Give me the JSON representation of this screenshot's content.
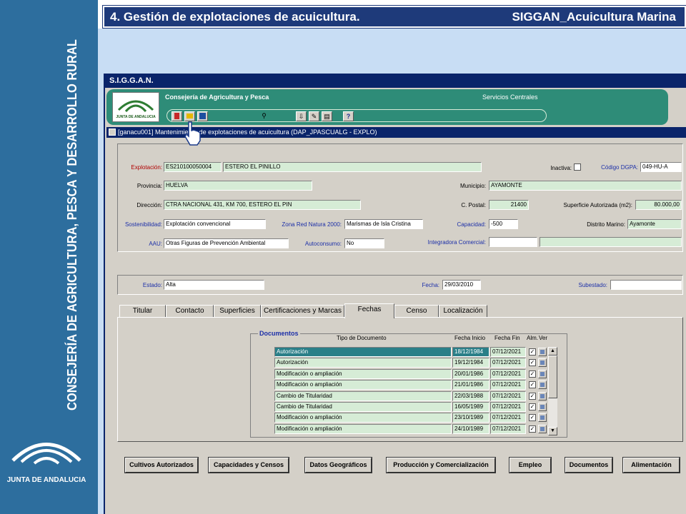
{
  "sidebar": {
    "vertical_text": "CONSEJERÍA DE AGRICULTURA, PESCA Y DESARROLLO RURAL",
    "logo_caption": "JUNTA DE ANDALUCIA"
  },
  "header": {
    "title": "4. Gestión de explotaciones de acuicultura.",
    "right": "SIGGAN_Acuicultura Marina"
  },
  "window": {
    "title": "S.I.G.G.A.N."
  },
  "appbar": {
    "logo_caption": "JUNTA DE ANDALUCIA",
    "consejeria": "Consejería de Agricultura y Pesca",
    "servicios": "Servicios Centrales"
  },
  "form_title": "[ganacu001] Mantenimiento de explotaciones de acuicultura   (DAP_JPASCUALG - EXPLO)",
  "form": {
    "explotacion_label": "Explotación:",
    "explotacion_code": "ES210100050004",
    "explotacion_name": "ESTERO EL PINILLO",
    "inactiva_label": "Inactiva:",
    "codigo_dgpa_label": "Código DGPA:",
    "codigo_dgpa": "049-HU-A",
    "provincia_label": "Provincia:",
    "provincia": "HUELVA",
    "municipio_label": "Municipio:",
    "municipio": "AYAMONTE",
    "direccion_label": "Dirección:",
    "direccion": "CTRA NACIONAL 431, KM 700, ESTERO EL PIN",
    "cpostal_label": "C. Postal:",
    "cpostal": "21400",
    "superficie_label": "Superficie Autorizada (m2):",
    "superficie": "80.000,00",
    "sostenibilidad_label": "Sostenibilidad:",
    "sostenibilidad": "Explotación convencional",
    "zona_label": "Zona Red Natura 2000:",
    "zona": "Marismas de Isla Cristina",
    "capacidad_label": "Capacidad:",
    "capacidad": "-500",
    "distrito_label": "Distrito Marino:",
    "distrito": "Ayamonte",
    "aau_label": "AAU:",
    "aau": "Otras Figuras de Prevención Ambiental",
    "autoconsumo_label": "Autoconsumo:",
    "autoconsumo": "No",
    "integradora_label": "Integradora Comercial:",
    "integradora_code": "",
    "integradora_name": "",
    "estado_label": "Estado:",
    "estado": "Alta",
    "fecha_label": "Fecha:",
    "fecha": "29/03/2010",
    "subestado_label": "Subestado:",
    "subestado": ""
  },
  "tabs": [
    "Titular",
    "Contacto",
    "Superficies",
    "Certificaciones y Marcas",
    "Fechas",
    "Censo",
    "Localización"
  ],
  "active_tab": "Fechas",
  "documentos": {
    "label": "Documentos",
    "headers": [
      "Tipo de Documento",
      "Fecha Inicio",
      "Fecha Fin",
      "Alm.",
      "Ver"
    ],
    "rows": [
      [
        "Autorización",
        "18/12/1984",
        "07/12/2021"
      ],
      [
        "Autorización",
        "19/12/1984",
        "07/12/2021"
      ],
      [
        "Modificación o ampliación",
        "20/01/1986",
        "07/12/2021"
      ],
      [
        "Modificación o ampliación",
        "21/01/1986",
        "07/12/2021"
      ],
      [
        "Cambio de Titularidad",
        "22/03/1988",
        "07/12/2021"
      ],
      [
        "Cambio de Titularidad",
        "16/05/1989",
        "07/12/2021"
      ],
      [
        "Modificación o ampliación",
        "23/10/1989",
        "07/12/2021"
      ],
      [
        "Modificación o ampliación",
        "24/10/1989",
        "07/12/2021"
      ]
    ]
  },
  "buttons": [
    "Cultivos Autorizados",
    "Capacidades y Censos",
    "Datos Geográficos",
    "Producción y Comercialización",
    "Empleo",
    "Documentos",
    "Alimentación"
  ],
  "colors": {
    "sidebar": "#2d6e9e",
    "header": "#1e3a7a",
    "appbar": "#2e8c78",
    "field": "#d6ecd6",
    "selected": "#2a7f88",
    "label_blue": "#1c2fa8",
    "label_red": "#b00000"
  }
}
